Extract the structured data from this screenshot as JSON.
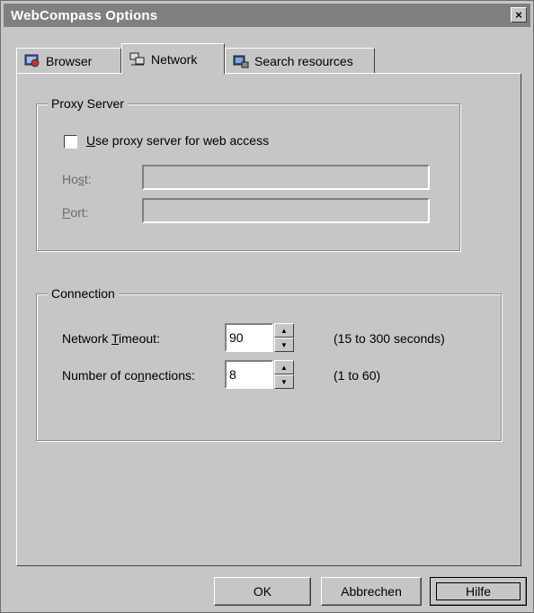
{
  "window": {
    "title": "WebCompass Options",
    "close_glyph": "×"
  },
  "tabs": [
    {
      "label": "Browser",
      "icon": "browser-icon",
      "active": false
    },
    {
      "label": "Network",
      "icon": "network-icon",
      "active": true
    },
    {
      "label": "Search resources",
      "icon": "search-resources-icon",
      "active": false
    }
  ],
  "proxy": {
    "legend": "Proxy Server",
    "checkbox": {
      "label_pre": "",
      "label_u": "U",
      "label_post": "se proxy server for web access",
      "checked": false
    },
    "host": {
      "label_pre": "Ho",
      "label_u": "s",
      "label_post": "t:",
      "value": ""
    },
    "port": {
      "label_pre": "",
      "label_u": "P",
      "label_post": "ort:",
      "value": ""
    }
  },
  "connection": {
    "legend": "Connection",
    "timeout": {
      "label_pre": "Network ",
      "label_u": "T",
      "label_post": "imeout:",
      "value": "90",
      "range": "(15 to 300 seconds)"
    },
    "connections": {
      "label_pre": "Number of co",
      "label_u": "n",
      "label_post": "nections:",
      "value": "8",
      "range": "(1 to 60)"
    }
  },
  "buttons": {
    "ok": "OK",
    "cancel": "Abbrechen",
    "help": "Hilfe"
  },
  "colors": {
    "face": "#c6c6c6",
    "title_bg": "#808080"
  }
}
